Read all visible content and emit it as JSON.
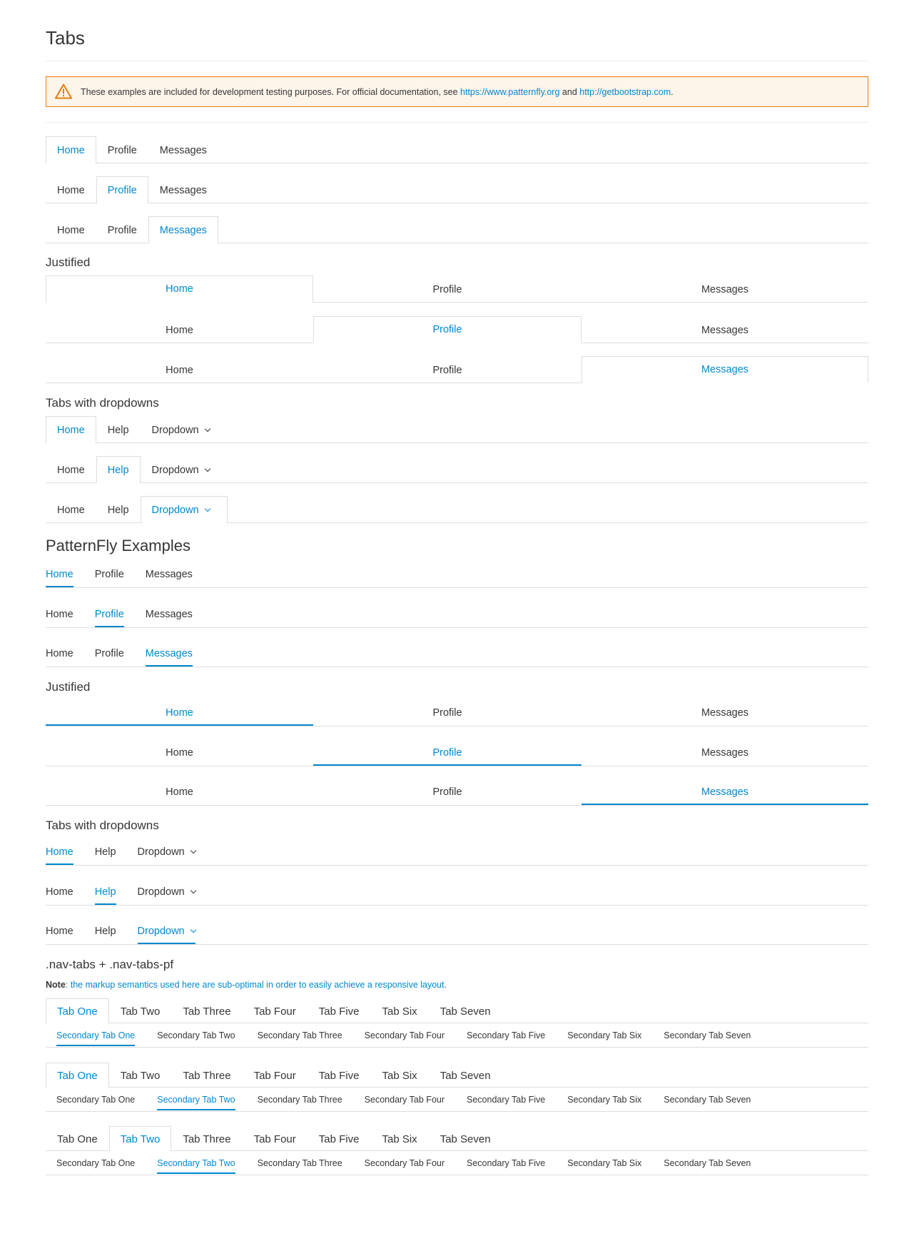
{
  "page_title": "Tabs",
  "alert": {
    "text_before": "These examples are included for development testing purposes. For official documentation, see ",
    "link1": "https://www.patternfly.org",
    "text_mid": " and ",
    "link2": "http://getbootstrap.com",
    "text_after": ".",
    "accent": "#ec7a08"
  },
  "basic_tabs": [
    "Home",
    "Profile",
    "Messages"
  ],
  "justified_heading": "Justified",
  "dropdown_heading": "Tabs with dropdowns",
  "dropdown_tabs": [
    "Home",
    "Help",
    "Dropdown"
  ],
  "pf_heading": "PatternFly Examples",
  "pf_justified_heading": "Justified",
  "pf_dropdown_heading": "Tabs with dropdowns",
  "navtabs_heading": ".nav-tabs + .nav-tabs-pf",
  "note": {
    "label": "Note",
    "text": ": the markup semantics used here are sub-optimal in order to easily achieve a responsive layout."
  },
  "primary_tabs": [
    "Tab One",
    "Tab Two",
    "Tab Three",
    "Tab Four",
    "Tab Five",
    "Tab Six",
    "Tab Seven"
  ],
  "secondary_tabs": [
    "Secondary Tab One",
    "Secondary Tab Two",
    "Secondary Tab Three",
    "Secondary Tab Four",
    "Secondary Tab Five",
    "Secondary Tab Six",
    "Secondary Tab Seven"
  ],
  "colors": {
    "accent": "#0088ce",
    "border": "#dddddd",
    "text": "#363636"
  }
}
